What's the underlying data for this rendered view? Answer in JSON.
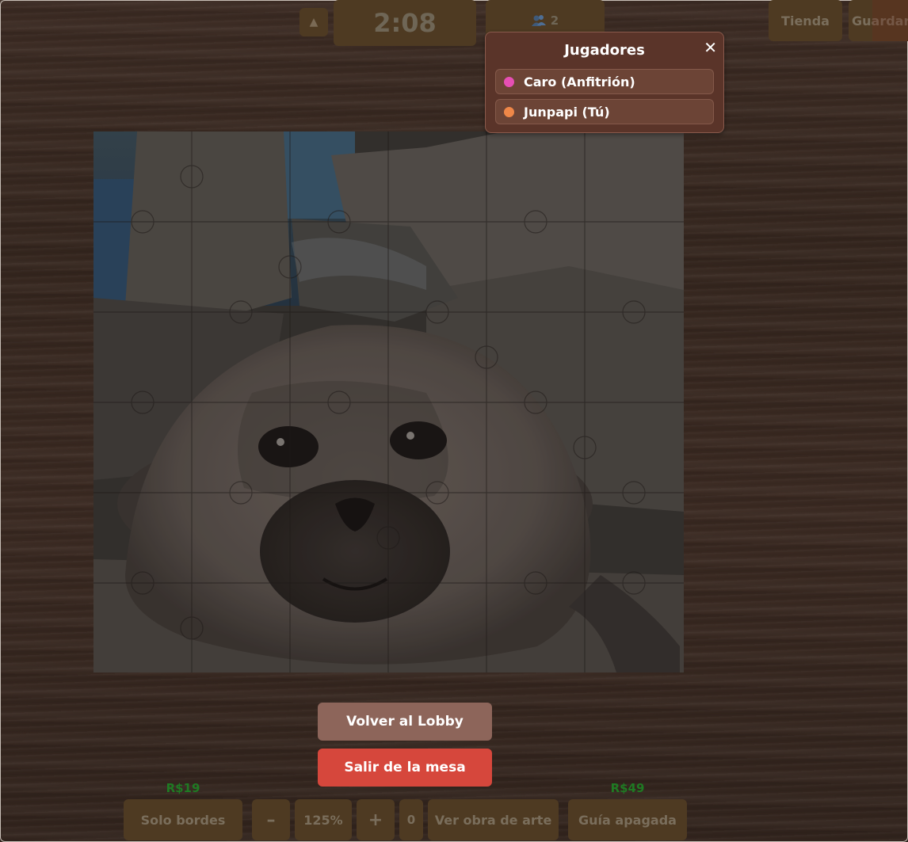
{
  "topbar": {
    "collapse_icon": "▲",
    "timer": "2:08",
    "players_icon": "players-icon",
    "players_count": "2",
    "shop_label": "Tienda",
    "save_label": "Guardar"
  },
  "players_panel": {
    "title": "Jugadores",
    "close_icon": "✕",
    "players": [
      {
        "name": "Caro (Anfitrión)",
        "color": "#e64fb4"
      },
      {
        "name": "Junpapi (Tú)",
        "color": "#ef8748"
      }
    ]
  },
  "puzzle": {
    "image_subject": "seal on rocks",
    "completion": 1.0
  },
  "actions": {
    "back_to_lobby": "Volver al Lobby",
    "leave_table": "Salir de la mesa"
  },
  "toolbar": {
    "edges_only": "Solo bordes",
    "edges_only_price": "R$19",
    "zoom_out": "–",
    "zoom_level": "125%",
    "zoom_in": "+",
    "counter": "0",
    "view_artwork": "Ver obra de arte",
    "guide": "Guía apagada",
    "guide_price": "R$49"
  },
  "colors": {
    "accent_red": "#d6473c",
    "lobby_button": "#8d655a",
    "panel_bg": "#5a3429",
    "price_green": "#1f7a23"
  }
}
